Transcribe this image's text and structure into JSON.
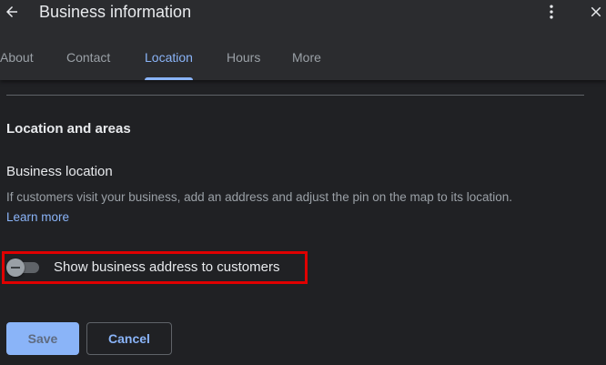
{
  "header": {
    "title": "Business information",
    "back_icon": "arrow-left-icon",
    "more_icon": "more-vert-icon",
    "close_icon": "close-icon"
  },
  "tabs": [
    {
      "label": "About",
      "active": false
    },
    {
      "label": "Contact",
      "active": false
    },
    {
      "label": "Location",
      "active": true
    },
    {
      "label": "Hours",
      "active": false
    },
    {
      "label": "More",
      "active": false
    }
  ],
  "section": {
    "title": "Location and areas",
    "subtitle": "Business location",
    "description": "If customers visit your business, add an address and adjust the pin on the map to its location.",
    "learn_more": "Learn more"
  },
  "toggle": {
    "label": "Show business address to customers",
    "checked": false
  },
  "buttons": {
    "save": "Save",
    "cancel": "Cancel"
  },
  "colors": {
    "background": "#202124",
    "header_background": "#2b2c2f",
    "accent": "#8ab4f8",
    "highlight": "#e00000",
    "text_primary": "#e8eaed",
    "text_secondary": "#9aa0a6"
  }
}
